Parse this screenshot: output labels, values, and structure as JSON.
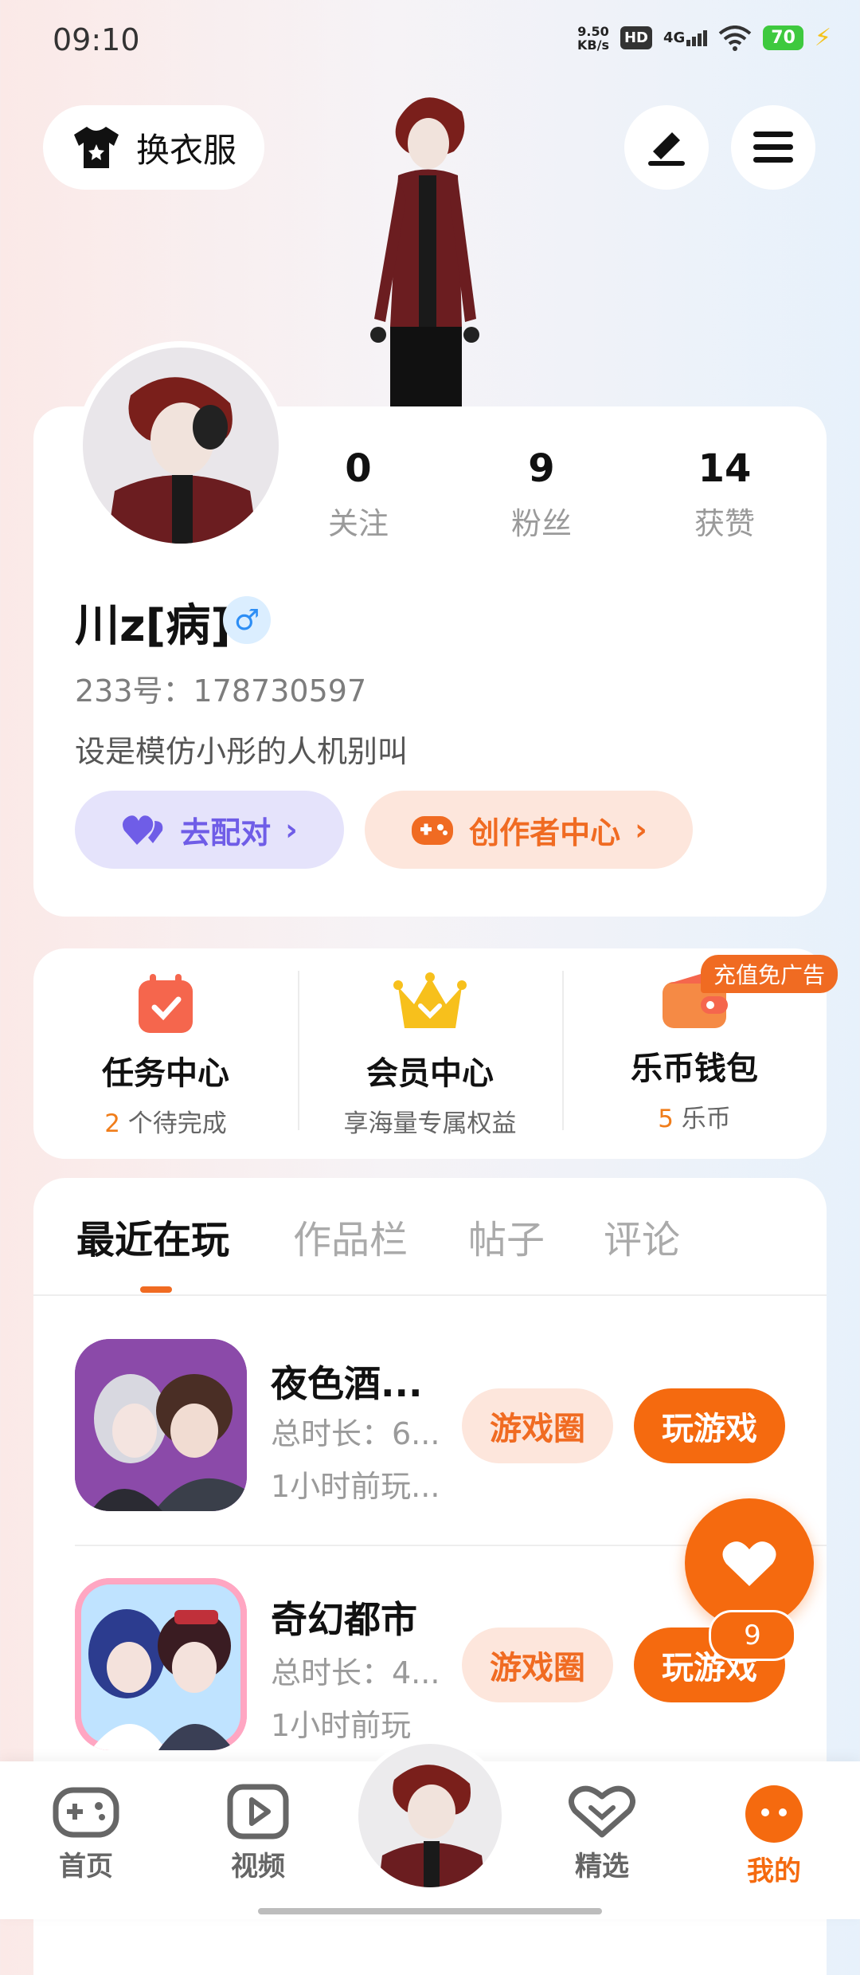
{
  "status_bar": {
    "time": "09:10",
    "net_speed": "9.50",
    "net_unit": "KB/s",
    "hd": "HD",
    "network": "4G",
    "battery": "70"
  },
  "top_bar": {
    "outfit_label": "换衣服",
    "icons": [
      "tshirt-icon",
      "edit-icon",
      "menu-icon"
    ]
  },
  "profile": {
    "stats": [
      {
        "value": "0",
        "label": "关注"
      },
      {
        "value": "9",
        "label": "粉丝"
      },
      {
        "value": "14",
        "label": "获赞"
      }
    ],
    "username": "川z[病]",
    "gender_symbol": "♂",
    "uid": "233号：178730597",
    "bio": "设是模仿小彤的人机别叫",
    "match_label": "去配对",
    "creator_label": "创作者中心"
  },
  "quick_actions": [
    {
      "title": "任务中心",
      "count": "2",
      "sub": " 个待完成",
      "icon": "task-calendar-icon"
    },
    {
      "title": "会员中心",
      "sub": "享海量专属权益",
      "icon": "crown-icon"
    },
    {
      "title": "乐币钱包",
      "count": "5",
      "sub": " 乐币",
      "icon": "wallet-icon",
      "badge": "充值免广告"
    }
  ],
  "tabs": [
    "最近在玩",
    "作品栏",
    "帖子",
    "评论"
  ],
  "games": [
    {
      "title": "夜色酒...",
      "duration": "总时长：6...",
      "last_played": "1小时前玩...",
      "circle_label": "游戏圈",
      "play_label": "玩游戏"
    },
    {
      "title": "奇幻都市",
      "duration": "总时长：4...",
      "last_played": "1小时前玩",
      "circle_label": "游戏圈",
      "play_label": "玩游戏"
    }
  ],
  "fab": {
    "count": "9"
  },
  "bottom_nav": [
    {
      "label": "首页",
      "icon": "gamepad-icon"
    },
    {
      "label": "视频",
      "icon": "video-play-icon"
    },
    {
      "label": "精选",
      "icon": "heart-chat-icon"
    },
    {
      "label": "我的",
      "icon": "profile-face-icon"
    }
  ],
  "colors": {
    "accent": "#f56a0f",
    "match_purple": "#6f5de7",
    "gender_blue": "#2d8ef5"
  }
}
